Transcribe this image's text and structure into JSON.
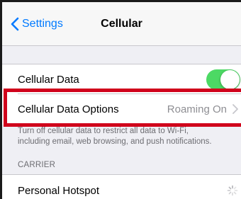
{
  "nav": {
    "back_label": "Settings",
    "title": "Cellular"
  },
  "rows": {
    "cellular_data": {
      "label": "Cellular Data",
      "enabled": true
    },
    "cellular_data_options": {
      "label": "Cellular Data Options",
      "value": "Roaming On"
    },
    "personal_hotspot": {
      "label": "Personal Hotspot"
    }
  },
  "footer": {
    "line1": "Turn off cellular data to restrict all data to Wi-Fi,",
    "line2": "including email, web browsing, and push notifications."
  },
  "section": {
    "header": "CARRIER"
  },
  "colors": {
    "accent": "#007aff",
    "toggle_on": "#4cd964",
    "highlight": "#d0021b"
  },
  "icons": [
    "chevron-left-icon",
    "chevron-right-icon",
    "loading-spinner-icon"
  ]
}
